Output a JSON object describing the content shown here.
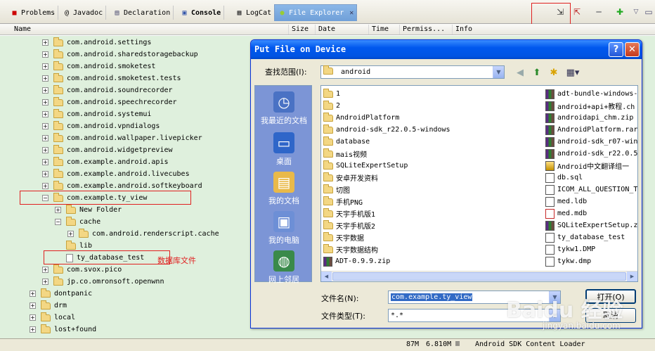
{
  "tabs": [
    {
      "label": "Problems",
      "icon": "problems-icon"
    },
    {
      "label": "@ Javadoc",
      "icon": ""
    },
    {
      "label": "Declaration",
      "icon": "declaration-icon"
    },
    {
      "label": "Console",
      "icon": "console-icon"
    },
    {
      "label": "LogCat",
      "icon": "logcat-icon"
    },
    {
      "label": "File Explorer",
      "icon": "android-icon"
    }
  ],
  "toolbar": [
    "pull-file-icon",
    "push-file-icon",
    "delete-icon",
    "new-folder-icon",
    "view-menu-icon"
  ],
  "columns": [
    "Name",
    "Size",
    "Date",
    "Time",
    "Permiss...",
    "Info"
  ],
  "tree": [
    {
      "label": "com.android.settings",
      "type": "folder",
      "expand": "+"
    },
    {
      "label": "com.android.sharedstoragebackup",
      "type": "folder",
      "expand": "+"
    },
    {
      "label": "com.android.smoketest",
      "type": "folder",
      "expand": "+"
    },
    {
      "label": "com.android.smoketest.tests",
      "type": "folder",
      "expand": "+"
    },
    {
      "label": "com.android.soundrecorder",
      "type": "folder",
      "expand": "+"
    },
    {
      "label": "com.android.speechrecorder",
      "type": "folder",
      "expand": "+"
    },
    {
      "label": "com.android.systemui",
      "type": "folder",
      "expand": "+"
    },
    {
      "label": "com.android.vpndialogs",
      "type": "folder",
      "expand": "+"
    },
    {
      "label": "com.android.wallpaper.livepicker",
      "type": "folder",
      "expand": "+"
    },
    {
      "label": "com.android.widgetpreview",
      "type": "folder",
      "expand": "+"
    },
    {
      "label": "com.example.android.apis",
      "type": "folder",
      "expand": "+"
    },
    {
      "label": "com.example.android.livecubes",
      "type": "folder",
      "expand": "+"
    },
    {
      "label": "com.example.android.softkeyboard",
      "type": "folder",
      "expand": "+"
    },
    {
      "label": "com.example.ty_view",
      "type": "folder",
      "expand": "-"
    },
    {
      "label": "New Folder",
      "type": "folder",
      "expand": "+"
    },
    {
      "label": "cache",
      "type": "folder",
      "expand": "-"
    },
    {
      "label": "com.android.renderscript.cache",
      "type": "folder",
      "expand": "+"
    },
    {
      "label": "lib",
      "type": "folder",
      "expand": ""
    },
    {
      "label": "ty_database_test",
      "type": "file",
      "expand": ""
    },
    {
      "label": "com.svox.pico",
      "type": "folder",
      "expand": "+"
    },
    {
      "label": "jp.co.omronsoft.openwnn",
      "type": "folder",
      "expand": "+"
    },
    {
      "label": "dontpanic",
      "type": "folder",
      "expand": "+"
    },
    {
      "label": "drm",
      "type": "folder",
      "expand": "+"
    },
    {
      "label": "local",
      "type": "folder",
      "expand": "+"
    },
    {
      "label": "lost+found",
      "type": "folder",
      "expand": "+"
    }
  ],
  "annotation": "数据库文件",
  "dialog": {
    "title": "Put File on Device",
    "help": "?",
    "close": "✕",
    "look_in_label": "查找范围(I):",
    "look_in_value": "android",
    "places": [
      "我最近的文档",
      "桌面",
      "我的文档",
      "我的电脑",
      "网上邻居"
    ],
    "files_left": [
      "1",
      "2",
      "AndroidPlatform",
      "android-sdk_r22.0.5-windows",
      "database",
      "mais视频",
      "SQLiteExpertSetup",
      "安卓开发资料",
      "切图",
      "手机PNG",
      "天宇手机版1",
      "天宇手机版2",
      "天宇数据",
      "天宇数据结构",
      "ADT-0.9.9.zip"
    ],
    "files_right": [
      {
        "name": "adt-bundle-windows-",
        "kind": "rar"
      },
      {
        "name": "android+api+教程.ch",
        "kind": "rar"
      },
      {
        "name": "androidapi_chm.zip",
        "kind": "rar"
      },
      {
        "name": "AndroidPlatform.rar",
        "kind": "rar"
      },
      {
        "name": "android-sdk_r07-win",
        "kind": "rar"
      },
      {
        "name": "android-sdk_r22.0.5",
        "kind": "rar"
      },
      {
        "name": "Android中文翻译组一",
        "kind": "chm"
      },
      {
        "name": "db.sql",
        "kind": "doc"
      },
      {
        "name": "ICOM_ALL_QUESTION_T",
        "kind": "doc"
      },
      {
        "name": "med.ldb",
        "kind": "doc"
      },
      {
        "name": "med.mdb",
        "kind": "pdf"
      },
      {
        "name": "SQLiteExpertSetup.z",
        "kind": "rar"
      },
      {
        "name": "ty_database_test",
        "kind": "doc"
      },
      {
        "name": "tykw1.DMP",
        "kind": "doc"
      },
      {
        "name": "tykw.dmp",
        "kind": "doc"
      }
    ],
    "filename_label": "文件名(N):",
    "filename_value": "com.example.ty_view",
    "filetype_label": "文件类型(T):",
    "filetype_value": "*.*",
    "open_button": "打开(O)",
    "cancel_button": "取消"
  },
  "status": {
    "memory": "87M",
    "memory2": "6.810M",
    "task": "Android SDK Content Loader"
  },
  "watermark": {
    "brand": "Baidu 经验",
    "url": "jingyan.baidu.com"
  },
  "colors": {
    "tree_bg": "#dff0dd",
    "active_tab": "#7aa8e0",
    "red_box": "#e02020",
    "dialog_title": "#0054e3"
  }
}
